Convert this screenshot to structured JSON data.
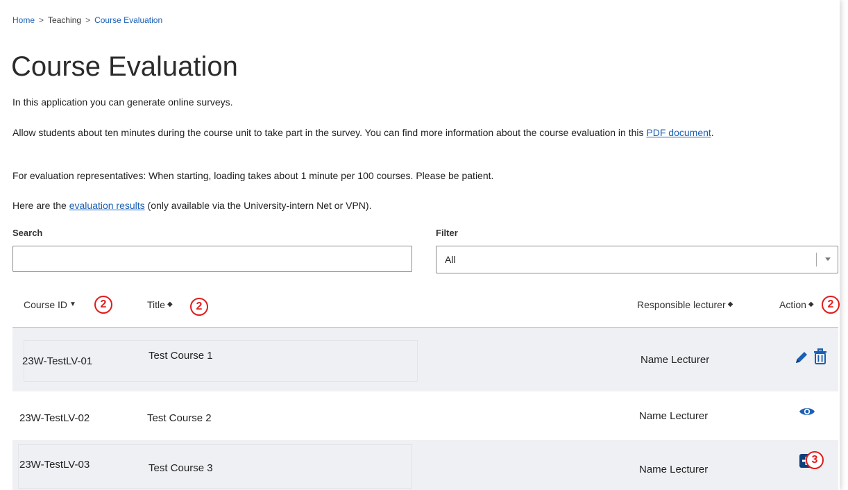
{
  "breadcrumb": {
    "home": "Home",
    "sep": ">",
    "teaching": "Teaching",
    "current": "Course Evaluation"
  },
  "page_title": "Course Evaluation",
  "intro": {
    "p1": "In this application you can generate online surveys.",
    "p2_text": "Allow students about ten minutes during the course unit to take part in the survey. You can find more information about the course evaluation in this ",
    "p2_link": "PDF document",
    "p2_end": ".",
    "p3": "For evaluation representatives: When starting, loading takes about 1 minute per 100 courses. Please be patient.",
    "p4_start": "Here are the ",
    "p4_link": "evaluation results",
    "p4_end": " (only available via the University-intern Net or VPN)."
  },
  "search": {
    "label": "Search",
    "value": ""
  },
  "filter": {
    "label": "Filter",
    "selected": "All"
  },
  "table": {
    "columns": {
      "course_id": "Course ID",
      "title": "Title",
      "lecturer": "Responsible lecturer",
      "action": "Action"
    },
    "rows": [
      {
        "course_id": "23W-TestLV-01",
        "title": "Test Course 1",
        "lecturer": "Name Lecturer",
        "actions": [
          "pencil-icon",
          "trash-icon"
        ]
      },
      {
        "course_id": "23W-TestLV-02",
        "title": "Test Course 2",
        "lecturer": "Name Lecturer",
        "actions": [
          "eye-icon"
        ]
      },
      {
        "course_id": "23W-TestLV-03",
        "title": "Test Course 3",
        "lecturer": "Name Lecturer",
        "actions": [
          "plus-square-icon"
        ]
      }
    ]
  },
  "annotations": {
    "sort_badge": "2",
    "add_badge": "3"
  },
  "colors": {
    "link": "#1a5fb4",
    "annotation": "#e21b1b",
    "row_alt": "#eef0f3"
  }
}
